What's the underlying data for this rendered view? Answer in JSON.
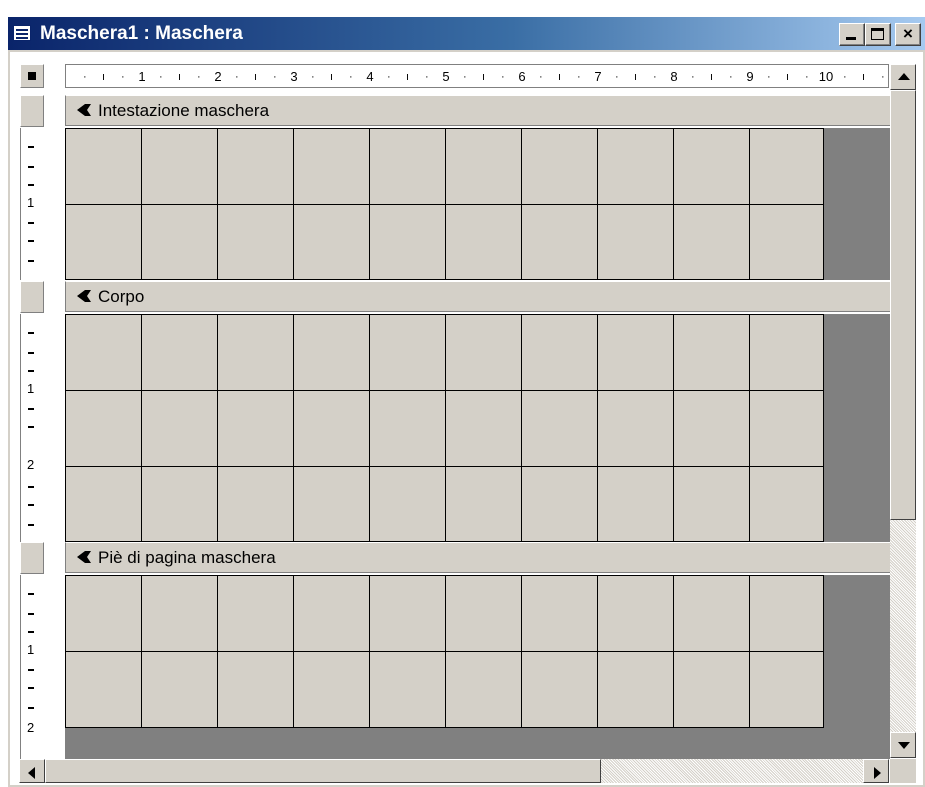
{
  "window": {
    "title": "Maschera1 : Maschera",
    "icon": "form-window-icon",
    "buttons": {
      "minimize": "minimize-icon",
      "maximize": "maximize-icon",
      "close": "close-icon",
      "close_glyph": "×"
    }
  },
  "ruler": {
    "ticks": [
      "1",
      "2",
      "3",
      "4",
      "5",
      "6",
      "7",
      "8",
      "9",
      "10"
    ],
    "vertical_labels": [
      "1",
      "2"
    ]
  },
  "sections": [
    {
      "label": "Intestazione maschera",
      "icon": "section-selector-icon"
    },
    {
      "label": "Corpo",
      "icon": "section-selector-icon"
    },
    {
      "label": "Piè di pagina maschera",
      "icon": "section-selector-icon"
    }
  ],
  "colors": {
    "title_start": "#0a246a",
    "title_end": "#a6caf0",
    "face": "#d4d0c8",
    "out_of_form": "#808080"
  }
}
